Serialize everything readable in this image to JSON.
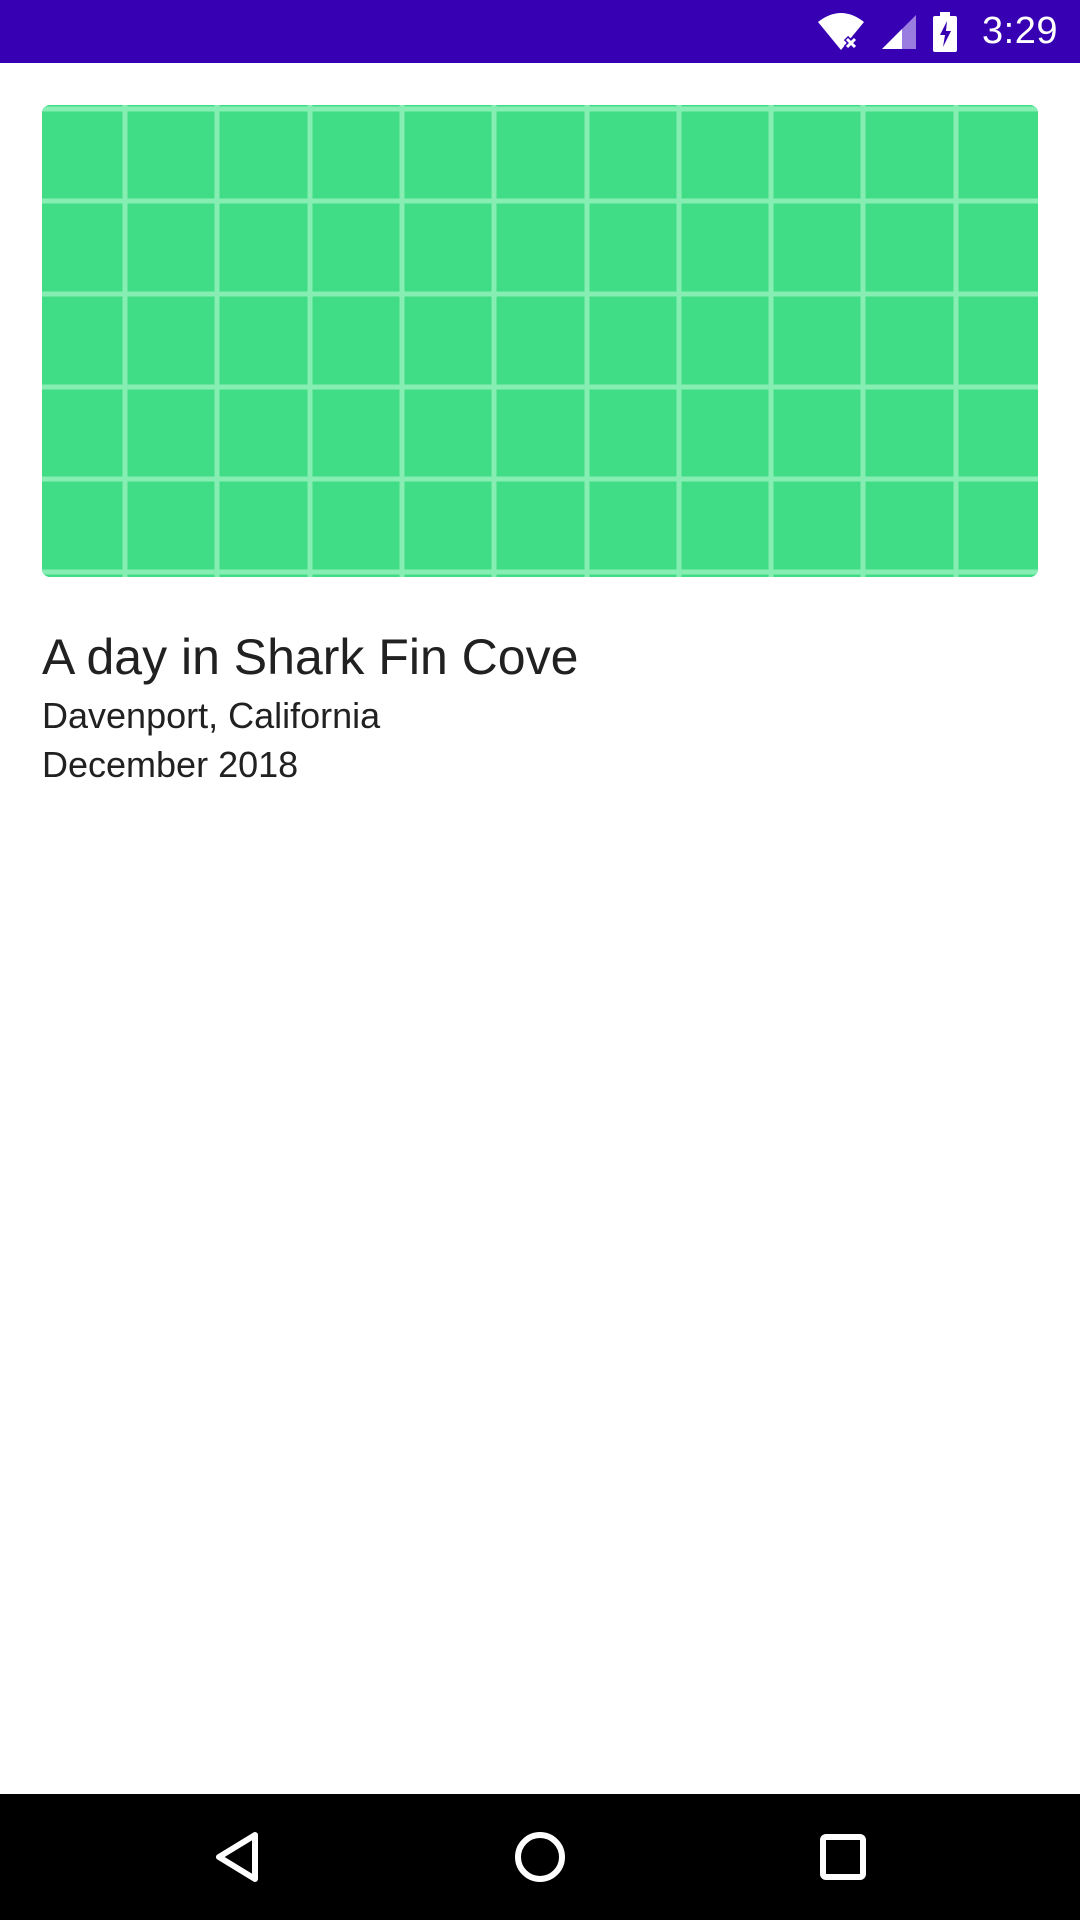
{
  "status_bar": {
    "time": "3:29",
    "background_color": "#3700b3",
    "icons": [
      "wifi-no-internet-icon",
      "cell-signal-icon",
      "battery-charging-icon"
    ]
  },
  "card": {
    "image_placeholder_color": "#40dc86",
    "title": "A day in Shark Fin Cove",
    "location": "Davenport, California",
    "date": "December 2018"
  },
  "nav_bar": {
    "background_color": "#000000",
    "buttons": [
      "back-icon",
      "home-icon",
      "recents-icon"
    ]
  }
}
